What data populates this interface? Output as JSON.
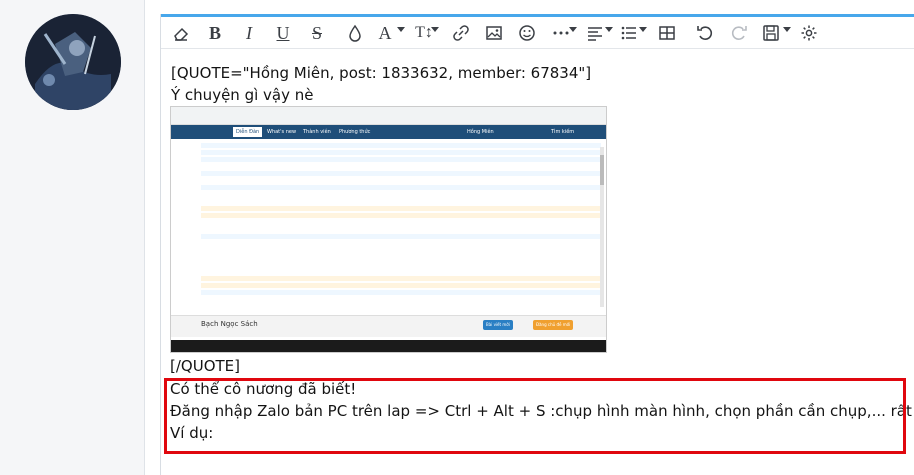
{
  "post": {
    "avatar_alt": "user avatar"
  },
  "toolbar": {
    "items": [
      {
        "name": "eraser-icon"
      },
      {
        "name": "bold-button",
        "label": "B"
      },
      {
        "name": "italic-button",
        "label": "I"
      },
      {
        "name": "underline-button",
        "label": "U"
      },
      {
        "name": "strikethrough-button",
        "label": "S"
      },
      {
        "name": "text-color-icon"
      },
      {
        "name": "font-family-button",
        "label": "A"
      },
      {
        "name": "font-size-button",
        "label": "T↕"
      },
      {
        "name": "link-icon"
      },
      {
        "name": "image-icon"
      },
      {
        "name": "emoji-icon"
      },
      {
        "name": "more-icon"
      },
      {
        "name": "align-icon"
      },
      {
        "name": "list-icon"
      },
      {
        "name": "table-icon"
      },
      {
        "name": "undo-icon"
      },
      {
        "name": "redo-icon"
      },
      {
        "name": "save-draft-icon"
      },
      {
        "name": "settings-icon"
      }
    ]
  },
  "content": {
    "quote_open": "[QUOTE=\"Hồng Miên, post: 1833632, member: 67834\"]",
    "quote_line": "Ý chuyện gì vậy nè",
    "quote_close": "[/QUOTE]",
    "reply_lines": [
      "Có thể cô nương đã biết!",
      "Đăng nhập Zalo bản PC trên lap => Ctrl + Alt + S :chụp hình màn hình, chọn phần cần chụp,... rất tiện.",
      "Ví dụ:"
    ]
  },
  "embedded_screenshot": {
    "nav_tabs": [
      "Diễn Đàn",
      "What's new",
      "Thành viên",
      "Phương thức"
    ],
    "user_label": "Hồng Miên",
    "search_label": "Tìm kiếm",
    "footer_title": "Bạch Ngọc Sách",
    "footer_buttons": [
      "Bài viết mới",
      "Đăng chủ đề mới"
    ]
  },
  "colors": {
    "accent": "#47a7eb",
    "highlight_border": "#e0070e",
    "embedded_nav": "#1f4e79"
  }
}
